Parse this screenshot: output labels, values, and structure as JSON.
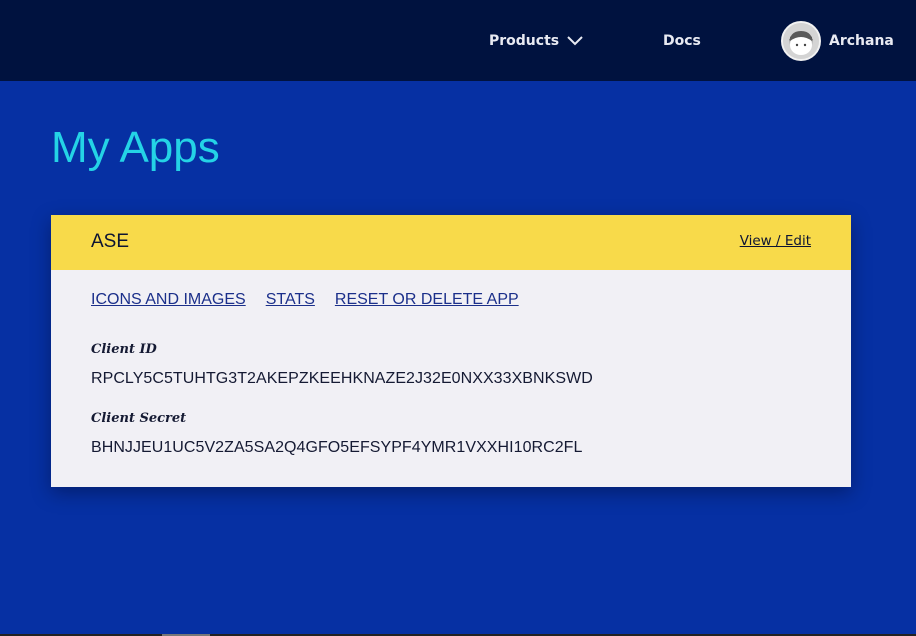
{
  "nav": {
    "products_label": "Products",
    "docs_label": "Docs",
    "user_name": "Archana"
  },
  "page": {
    "title": "My Apps"
  },
  "app_card": {
    "name": "ASE",
    "view_edit_label": "View / Edit",
    "links": [
      "ICONS AND IMAGES",
      "STATS",
      "RESET OR DELETE APP"
    ],
    "client_id_label": "Client ID",
    "client_id_value": "RPCLY5C5TUHTG3T2AKEPZKEEHKNAZE2J32E0NXX33XBNKSWD",
    "client_secret_label": "Client Secret",
    "client_secret_value": "BHNJJEU1UC5V2ZA5SA2Q4GFO5EFSYPF4YMR1VXXHI10RC2FL"
  },
  "colors": {
    "background": "#0630a3",
    "topbar": "#00123f",
    "title": "#24d3e6",
    "card_header": "#f8da4a",
    "card_body": "#f1f0f5"
  },
  "icons": {
    "products_dropdown": "chevron-down-icon",
    "user_avatar": "avatar-icon"
  }
}
